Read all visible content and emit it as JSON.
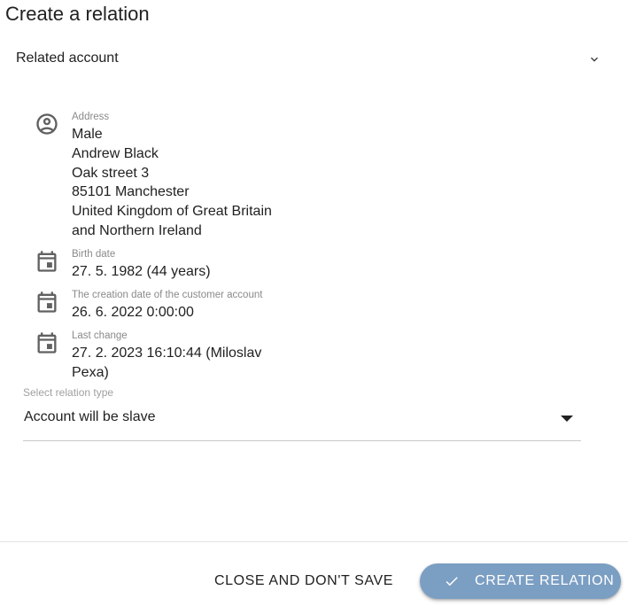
{
  "dialog": {
    "title": "Create a relation"
  },
  "related_account": {
    "header_label": "Related account"
  },
  "address": {
    "caption": "Address",
    "lines": [
      "Male",
      "Andrew Black",
      "Oak street 3",
      "85101 Manchester",
      "United Kingdom of Great Britain",
      "and Northern Ireland"
    ]
  },
  "birth_date": {
    "caption": "Birth date",
    "value": "27. 5. 1982 (44 years)"
  },
  "creation_date": {
    "caption": "The creation date of the customer account",
    "value": "26. 6. 2022 0:00:00"
  },
  "last_change": {
    "caption": "Last change",
    "lines": [
      "27. 2. 2023 16:10:44 (Miloslav",
      "Pexa)"
    ]
  },
  "relation_type": {
    "caption": "Select relation type",
    "selected": "Account will be slave"
  },
  "actions": {
    "close_label": "CLOSE AND DON'T SAVE",
    "create_label": "CREATE RELATION"
  },
  "colors": {
    "primary_button": "#7b9ec3",
    "icon": "#616161"
  }
}
